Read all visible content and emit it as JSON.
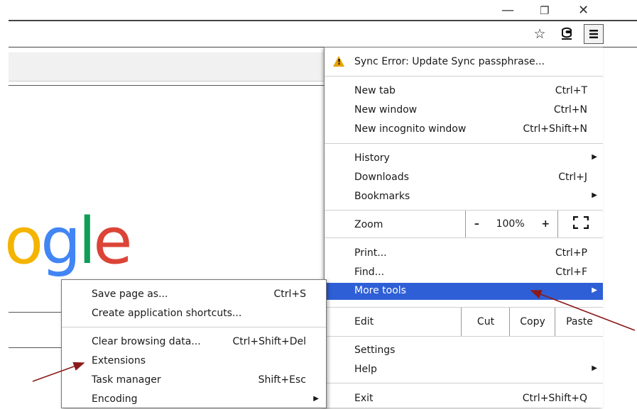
{
  "window": {
    "minimize_icon": "minimize-icon",
    "restore_icon": "restore-icon",
    "close_icon": "close-icon"
  },
  "toolbar": {
    "bookmark_star_icon": "star-icon",
    "extension_icon": "extension-icon",
    "menu_icon": "hamburger-menu-icon"
  },
  "logo": {
    "letters": [
      "o",
      "g",
      "l",
      "e"
    ],
    "colors": [
      "#f4b400",
      "#4285f4",
      "#0f9d58",
      "#db4437"
    ]
  },
  "menu": {
    "sync_error": "Sync Error: Update Sync passphrase...",
    "new_tab": "New tab",
    "new_tab_sc": "Ctrl+T",
    "new_window": "New window",
    "new_window_sc": "Ctrl+N",
    "new_incognito": "New incognito window",
    "new_incognito_sc": "Ctrl+Shift+N",
    "history": "History",
    "downloads": "Downloads",
    "downloads_sc": "Ctrl+J",
    "bookmarks": "Bookmarks",
    "zoom": "Zoom",
    "zoom_minus": "–",
    "zoom_value": "100%",
    "zoom_plus": "+",
    "print": "Print...",
    "print_sc": "Ctrl+P",
    "find": "Find...",
    "find_sc": "Ctrl+F",
    "more_tools": "More tools",
    "edit": "Edit",
    "cut": "Cut",
    "copy": "Copy",
    "paste": "Paste",
    "settings": "Settings",
    "help": "Help",
    "exit": "Exit",
    "exit_sc": "Ctrl+Shift+Q",
    "highlight_color": "#2f5fd6"
  },
  "submenu": {
    "save_page": "Save page as...",
    "save_page_sc": "Ctrl+S",
    "create_shortcuts": "Create application shortcuts...",
    "clear_data": "Clear browsing data...",
    "clear_data_sc": "Ctrl+Shift+Del",
    "extensions": "Extensions",
    "task_manager": "Task manager",
    "task_manager_sc": "Shift+Esc",
    "encoding": "Encoding"
  },
  "annotation_color": "#8b1a1a"
}
